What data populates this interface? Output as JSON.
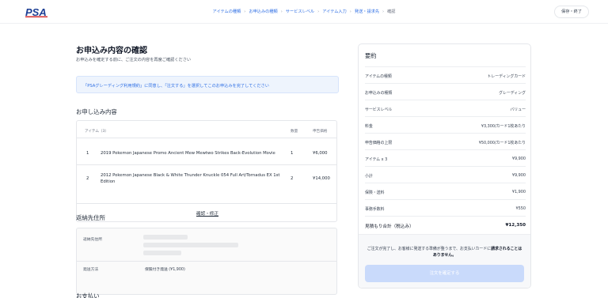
{
  "header": {
    "logo_text": "PSA",
    "steps": [
      "アイテムの種類",
      "お申込みの種類",
      "サービスレベル",
      "アイテム入力",
      "発送・請求先",
      "確認"
    ],
    "save_label": "保存・終了"
  },
  "main": {
    "title": "お申込み内容の確認",
    "description": "お申込みを確定する前に、ご注文の内容を再度ご確認ください",
    "notice": "「PSAグレーディング利用規約」に同意し、「注文する」を選択してこのお申込みを完了してください",
    "items_section": {
      "title": "お申し込み内容",
      "headers": {
        "item": "アイテム（3）",
        "qty": "数量",
        "declared": "申告価格"
      },
      "rows": [
        {
          "index": "1",
          "name": "2019 Pokemon Japanese Promo Ancient Mew Mewtwo Strikes Back-Evolution Movie",
          "qty": "1",
          "value": "¥6,000"
        },
        {
          "index": "2",
          "name": "2012 Pokemon Japanese Black & White Thunder Knuckle 054 Full Art/Tornadus EX 1st Edition",
          "qty": "2",
          "value": "¥14,000"
        }
      ],
      "confirm_link": "確認・修正"
    },
    "return_section": {
      "title": "返納先住所",
      "address_label": "返納先住所",
      "shipping_label": "発送方法",
      "shipping_value": "保険付き発送 (¥1,900)"
    },
    "payment_section": {
      "title": "お支払い"
    }
  },
  "summary": {
    "title": "要約",
    "rows": [
      {
        "label": "アイテムの種類",
        "value": "トレーディングカード"
      },
      {
        "label": "お申込みの種類",
        "value": "グレーディング"
      },
      {
        "label": "サービスレベル",
        "value": "バリュー"
      },
      {
        "label": "料金",
        "value": "¥3,300/カード1枚あたり"
      },
      {
        "label": "申告価格の上限",
        "value": "¥50,000/カード1枚あたり"
      },
      {
        "label": "アイテム x 3",
        "value": "¥9,900"
      },
      {
        "label": "小計",
        "value": "¥9,900"
      },
      {
        "label": "保険・送料",
        "value": "¥1,900"
      },
      {
        "label": "事務手数料",
        "value": "¥550"
      }
    ],
    "total_label": "見積もり合計（税込み）",
    "total_value": "¥12,350",
    "notice_normal": "ご注文が完了し、お客様に発送する準備が整うまで、お支払いカードに",
    "notice_bold": "請求されることはありません。",
    "submit_label": "注文を確定する"
  },
  "colors": {
    "accent": "#2f6fe4",
    "notice_bg": "#eef4fd",
    "button_disabled": "#c9dafb",
    "logo_blue": "#1d3f95",
    "logo_red": "#d62f2f"
  }
}
